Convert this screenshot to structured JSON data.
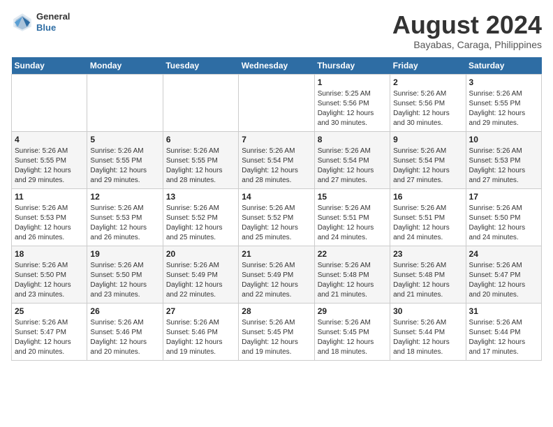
{
  "header": {
    "logo_line1": "General",
    "logo_line2": "Blue",
    "month_year": "August 2024",
    "location": "Bayabas, Caraga, Philippines"
  },
  "weekdays": [
    "Sunday",
    "Monday",
    "Tuesday",
    "Wednesday",
    "Thursday",
    "Friday",
    "Saturday"
  ],
  "weeks": [
    [
      {
        "day": "",
        "info": ""
      },
      {
        "day": "",
        "info": ""
      },
      {
        "day": "",
        "info": ""
      },
      {
        "day": "",
        "info": ""
      },
      {
        "day": "1",
        "info": "Sunrise: 5:25 AM\nSunset: 5:56 PM\nDaylight: 12 hours and 30 minutes."
      },
      {
        "day": "2",
        "info": "Sunrise: 5:26 AM\nSunset: 5:56 PM\nDaylight: 12 hours and 30 minutes."
      },
      {
        "day": "3",
        "info": "Sunrise: 5:26 AM\nSunset: 5:55 PM\nDaylight: 12 hours and 29 minutes."
      }
    ],
    [
      {
        "day": "4",
        "info": "Sunrise: 5:26 AM\nSunset: 5:55 PM\nDaylight: 12 hours and 29 minutes."
      },
      {
        "day": "5",
        "info": "Sunrise: 5:26 AM\nSunset: 5:55 PM\nDaylight: 12 hours and 29 minutes."
      },
      {
        "day": "6",
        "info": "Sunrise: 5:26 AM\nSunset: 5:55 PM\nDaylight: 12 hours and 28 minutes."
      },
      {
        "day": "7",
        "info": "Sunrise: 5:26 AM\nSunset: 5:54 PM\nDaylight: 12 hours and 28 minutes."
      },
      {
        "day": "8",
        "info": "Sunrise: 5:26 AM\nSunset: 5:54 PM\nDaylight: 12 hours and 27 minutes."
      },
      {
        "day": "9",
        "info": "Sunrise: 5:26 AM\nSunset: 5:54 PM\nDaylight: 12 hours and 27 minutes."
      },
      {
        "day": "10",
        "info": "Sunrise: 5:26 AM\nSunset: 5:53 PM\nDaylight: 12 hours and 27 minutes."
      }
    ],
    [
      {
        "day": "11",
        "info": "Sunrise: 5:26 AM\nSunset: 5:53 PM\nDaylight: 12 hours and 26 minutes."
      },
      {
        "day": "12",
        "info": "Sunrise: 5:26 AM\nSunset: 5:53 PM\nDaylight: 12 hours and 26 minutes."
      },
      {
        "day": "13",
        "info": "Sunrise: 5:26 AM\nSunset: 5:52 PM\nDaylight: 12 hours and 25 minutes."
      },
      {
        "day": "14",
        "info": "Sunrise: 5:26 AM\nSunset: 5:52 PM\nDaylight: 12 hours and 25 minutes."
      },
      {
        "day": "15",
        "info": "Sunrise: 5:26 AM\nSunset: 5:51 PM\nDaylight: 12 hours and 24 minutes."
      },
      {
        "day": "16",
        "info": "Sunrise: 5:26 AM\nSunset: 5:51 PM\nDaylight: 12 hours and 24 minutes."
      },
      {
        "day": "17",
        "info": "Sunrise: 5:26 AM\nSunset: 5:50 PM\nDaylight: 12 hours and 24 minutes."
      }
    ],
    [
      {
        "day": "18",
        "info": "Sunrise: 5:26 AM\nSunset: 5:50 PM\nDaylight: 12 hours and 23 minutes."
      },
      {
        "day": "19",
        "info": "Sunrise: 5:26 AM\nSunset: 5:50 PM\nDaylight: 12 hours and 23 minutes."
      },
      {
        "day": "20",
        "info": "Sunrise: 5:26 AM\nSunset: 5:49 PM\nDaylight: 12 hours and 22 minutes."
      },
      {
        "day": "21",
        "info": "Sunrise: 5:26 AM\nSunset: 5:49 PM\nDaylight: 12 hours and 22 minutes."
      },
      {
        "day": "22",
        "info": "Sunrise: 5:26 AM\nSunset: 5:48 PM\nDaylight: 12 hours and 21 minutes."
      },
      {
        "day": "23",
        "info": "Sunrise: 5:26 AM\nSunset: 5:48 PM\nDaylight: 12 hours and 21 minutes."
      },
      {
        "day": "24",
        "info": "Sunrise: 5:26 AM\nSunset: 5:47 PM\nDaylight: 12 hours and 20 minutes."
      }
    ],
    [
      {
        "day": "25",
        "info": "Sunrise: 5:26 AM\nSunset: 5:47 PM\nDaylight: 12 hours and 20 minutes."
      },
      {
        "day": "26",
        "info": "Sunrise: 5:26 AM\nSunset: 5:46 PM\nDaylight: 12 hours and 20 minutes."
      },
      {
        "day": "27",
        "info": "Sunrise: 5:26 AM\nSunset: 5:46 PM\nDaylight: 12 hours and 19 minutes."
      },
      {
        "day": "28",
        "info": "Sunrise: 5:26 AM\nSunset: 5:45 PM\nDaylight: 12 hours and 19 minutes."
      },
      {
        "day": "29",
        "info": "Sunrise: 5:26 AM\nSunset: 5:45 PM\nDaylight: 12 hours and 18 minutes."
      },
      {
        "day": "30",
        "info": "Sunrise: 5:26 AM\nSunset: 5:44 PM\nDaylight: 12 hours and 18 minutes."
      },
      {
        "day": "31",
        "info": "Sunrise: 5:26 AM\nSunset: 5:44 PM\nDaylight: 12 hours and 17 minutes."
      }
    ]
  ]
}
